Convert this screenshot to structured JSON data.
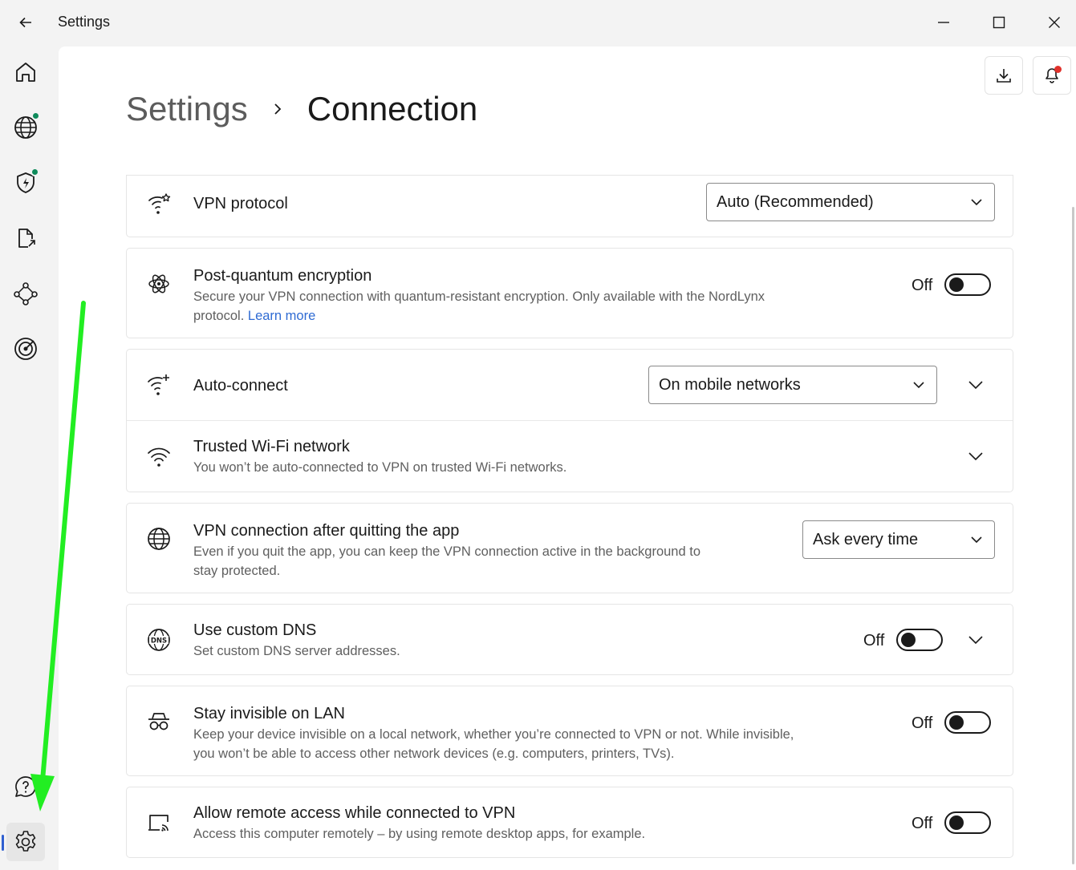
{
  "window": {
    "title": "Settings",
    "back_icon": "arrow-left-icon",
    "controls": [
      "minimize-icon",
      "maximize-icon",
      "close-icon"
    ]
  },
  "sidebar": {
    "items": [
      {
        "name": "home",
        "icon": "home-icon"
      },
      {
        "name": "globe",
        "icon": "globe-icon",
        "status_color": "#0e8a5a"
      },
      {
        "name": "threat-protection",
        "icon": "shield-bolt-icon",
        "status_color": "#0e8a5a"
      },
      {
        "name": "file-share",
        "icon": "file-share-icon"
      },
      {
        "name": "meshnet",
        "icon": "meshnet-icon"
      },
      {
        "name": "dark-web-monitor",
        "icon": "target-icon"
      }
    ],
    "bottom_items": [
      {
        "name": "help",
        "icon": "help-chat-icon"
      },
      {
        "name": "settings",
        "icon": "gear-icon",
        "active": true
      }
    ],
    "accent_color": "#2f5fd0"
  },
  "topbar": {
    "download_icon": "download-icon",
    "notification_icon": "bell-icon",
    "notification_dot_color": "#e0312b"
  },
  "breadcrumb": {
    "parent": "Settings",
    "current": "Connection"
  },
  "settings": {
    "vpn_protocol": {
      "title": "VPN protocol",
      "icon": "wifi-star-icon",
      "selected": "Auto (Recommended)"
    },
    "post_quantum": {
      "title": "Post-quantum encryption",
      "icon": "atom-icon",
      "desc": "Secure your VPN connection with quantum-resistant encryption. Only available with the NordLynx",
      "desc2": "protocol.",
      "link": "Learn more",
      "state": "Off"
    },
    "auto_connect": {
      "title": "Auto-connect",
      "icon": "wifi-sparkle-icon",
      "selected": "On mobile networks"
    },
    "trusted_wifi": {
      "title": "Trusted Wi-Fi network",
      "icon": "wifi-icon",
      "desc": "You won’t be auto-connected to VPN on trusted Wi-Fi networks."
    },
    "after_quit": {
      "title": "VPN connection after quitting the app",
      "icon": "globe-icon",
      "desc": "Even if you quit the app, you can keep the VPN connection active in the background to",
      "desc2": "stay protected.",
      "selected": "Ask every time"
    },
    "custom_dns": {
      "title": "Use custom DNS",
      "icon": "dns-globe-icon",
      "desc": "Set custom DNS server addresses.",
      "state": "Off"
    },
    "invisible_lan": {
      "title": "Stay invisible on LAN",
      "icon": "incognito-icon",
      "desc": "Keep your device invisible on a local network, whether you’re connected to VPN or not. While invisible,",
      "desc2": "you won’t be able to access other network devices (e.g. computers, printers, TVs).",
      "state": "Off"
    },
    "remote_access": {
      "title": "Allow remote access while connected to VPN",
      "icon": "remote-screen-icon",
      "desc": "Access this computer remotely – by using remote desktop apps, for example.",
      "state": "Off"
    }
  },
  "annotation": {
    "arrow_color": "#22ee22",
    "arrow_icon": "green-arrow-pointing-to-settings"
  }
}
